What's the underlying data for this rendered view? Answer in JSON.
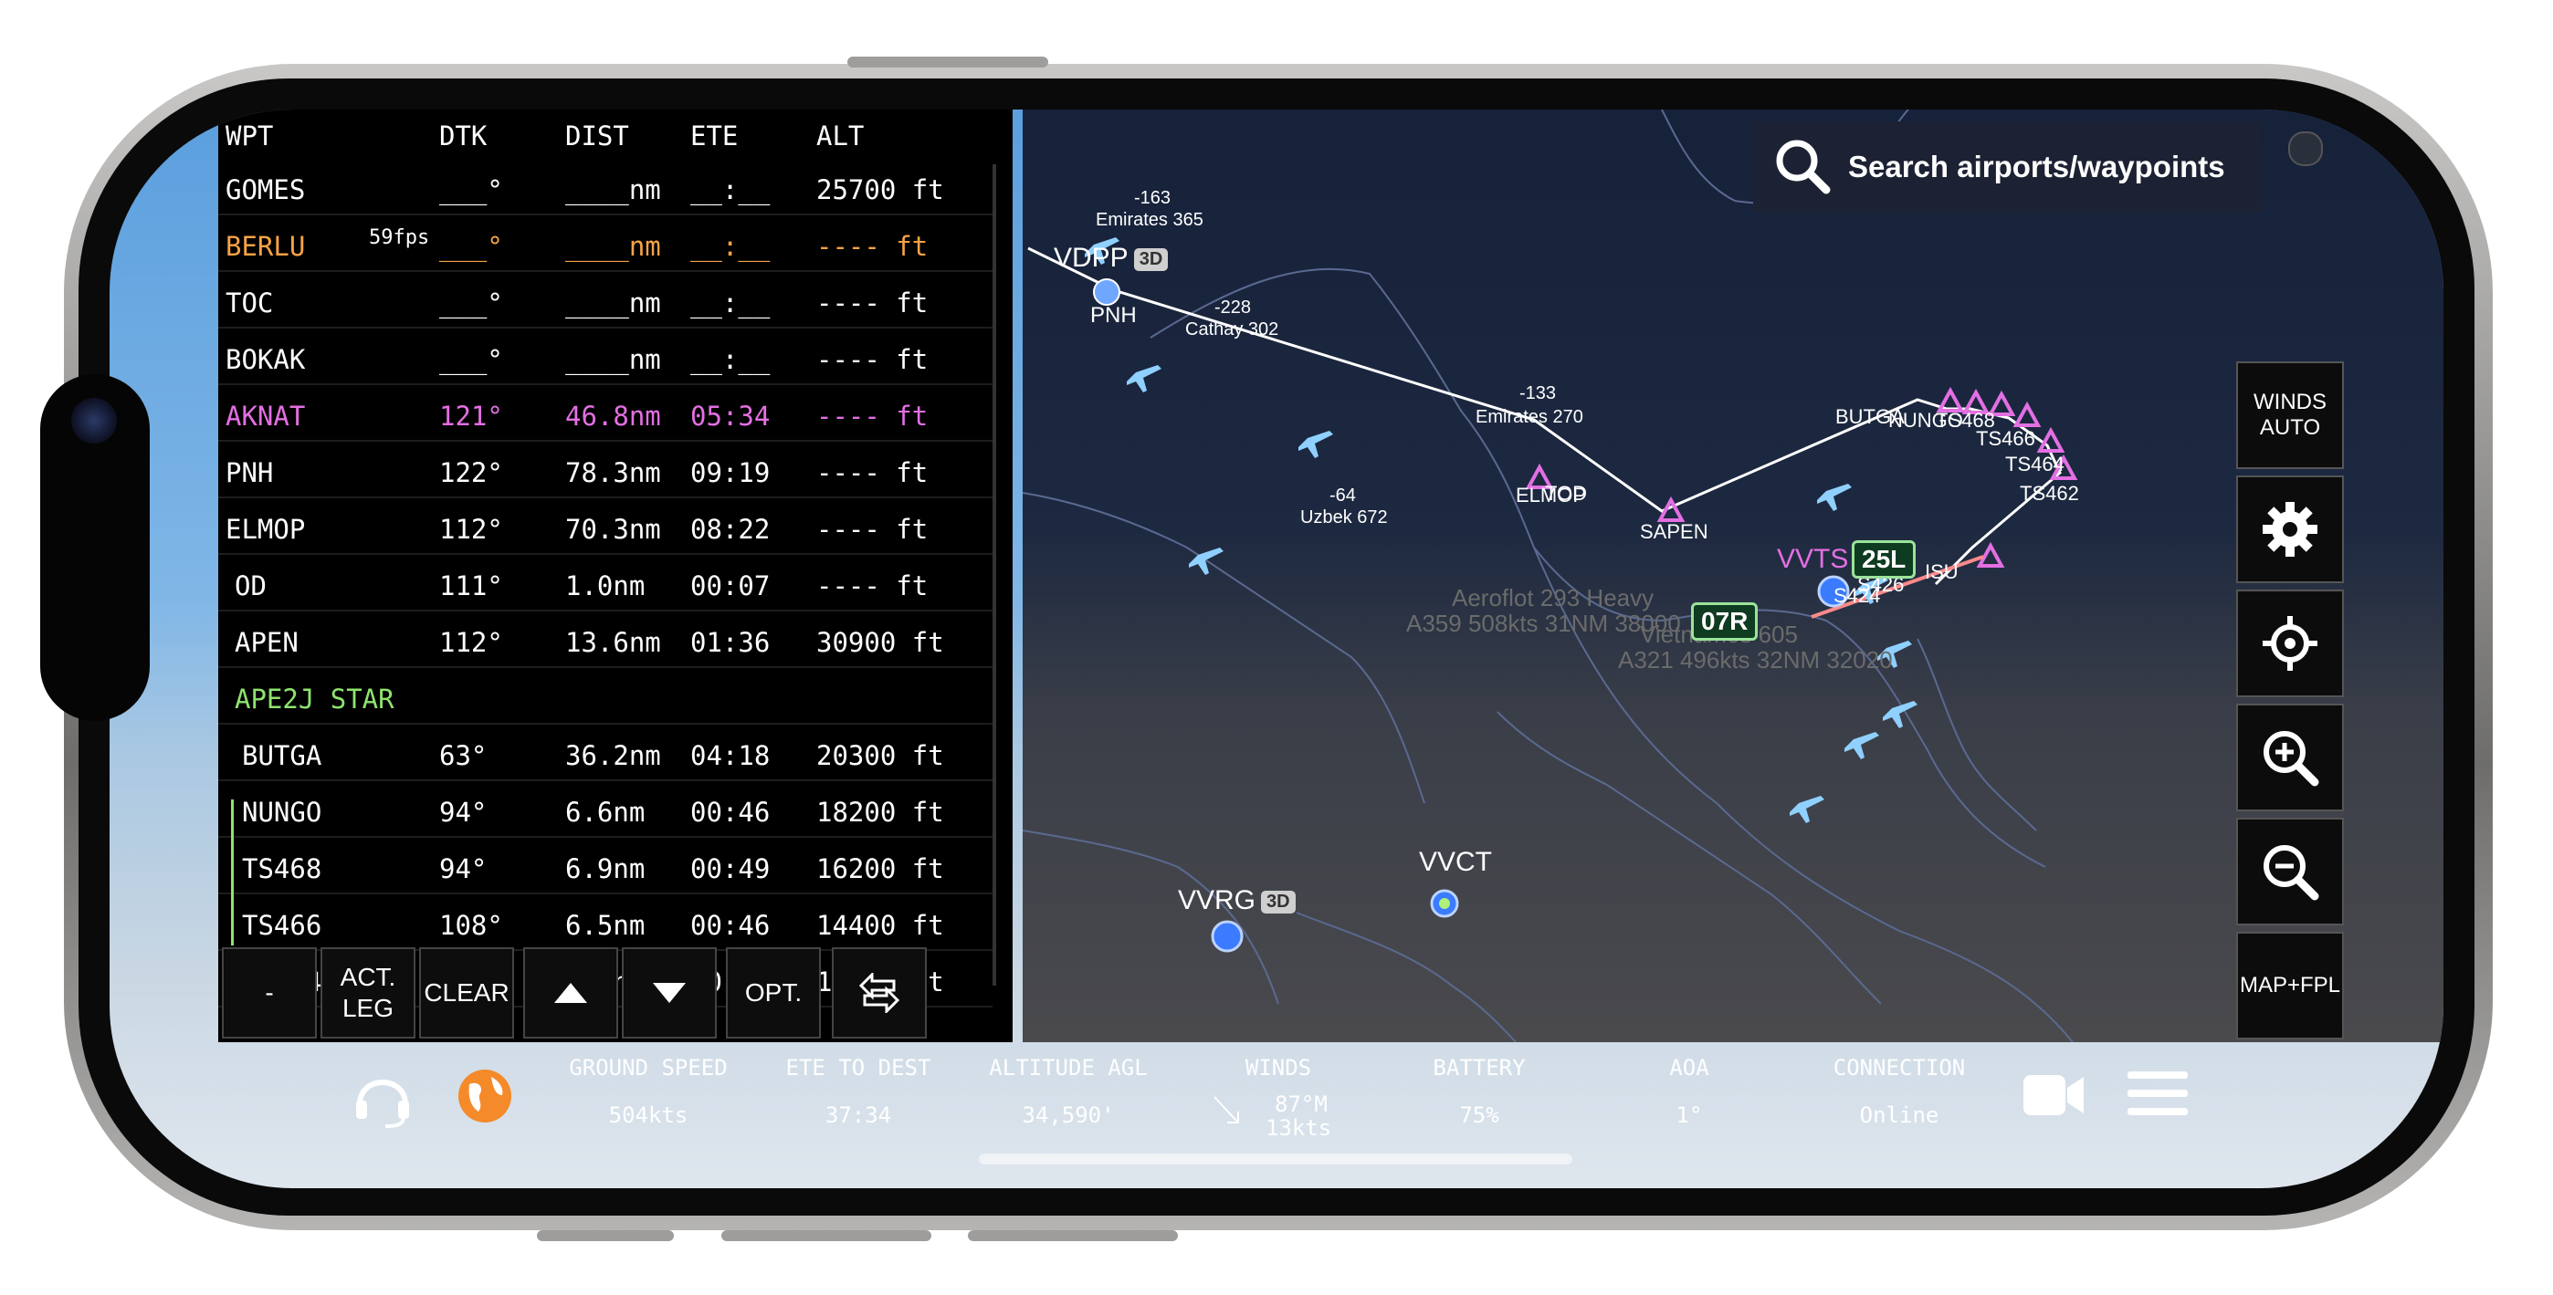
{
  "fpl": {
    "headers": [
      "WPT",
      "DTK",
      "DIST",
      "ETE",
      "ALT"
    ],
    "fps": "59fps",
    "rows": [
      {
        "wpt": "GOMES",
        "dtk": "___°",
        "dist": "____nm",
        "ete": "__:__",
        "alt": "25700 ft",
        "style": "normal"
      },
      {
        "wpt": "BERLU",
        "dtk": "___°",
        "dist": "____nm",
        "ete": "__:__",
        "alt": "---- ft",
        "style": "orange"
      },
      {
        "wpt": "TOC",
        "dtk": "___°",
        "dist": "____nm",
        "ete": "__:__",
        "alt": "---- ft",
        "style": "normal"
      },
      {
        "wpt": "BOKAK",
        "dtk": "___°",
        "dist": "____nm",
        "ete": "__:__",
        "alt": "---- ft",
        "style": "normal"
      },
      {
        "wpt": "AKNAT",
        "dtk": "121°",
        "dist": "46.8nm",
        "ete": "05:34",
        "alt": "---- ft",
        "style": "magenta"
      },
      {
        "wpt": "PNH",
        "dtk": "122°",
        "dist": "78.3nm",
        "ete": "09:19",
        "alt": "---- ft",
        "style": "normal"
      },
      {
        "wpt": "ELMOP",
        "dtk": "112°",
        "dist": "70.3nm",
        "ete": "08:22",
        "alt": "---- ft",
        "style": "normal"
      },
      {
        "wpt": "OD",
        "dtk": "111°",
        "dist": "1.0nm",
        "ete": "00:07",
        "alt": "---- ft",
        "style": "normal"
      },
      {
        "wpt": "APEN",
        "dtk": "112°",
        "dist": "13.6nm",
        "ete": "01:36",
        "alt": "30900 ft",
        "style": "normal"
      },
      {
        "wpt": "APE2J STAR",
        "dtk": "",
        "dist": "",
        "ete": "",
        "alt": "",
        "style": "star"
      },
      {
        "wpt": "BUTGA",
        "dtk": "63°",
        "dist": "36.2nm",
        "ete": "04:18",
        "alt": "20300 ft",
        "style": "normal"
      },
      {
        "wpt": "NUNGO",
        "dtk": "94°",
        "dist": "6.6nm",
        "ete": "00:46",
        "alt": "18200 ft",
        "style": "normal"
      },
      {
        "wpt": "TS468",
        "dtk": "94°",
        "dist": "6.9nm",
        "ete": "00:49",
        "alt": "16200 ft",
        "style": "normal"
      },
      {
        "wpt": "TS466",
        "dtk": "108°",
        "dist": "6.5nm",
        "ete": "00:46",
        "alt": "14400 ft",
        "style": "normal"
      },
      {
        "wpt": "TS464",
        "dtk": "125°",
        "dist": "6.5nm",
        "ete": "00:46",
        "alt": "12400 ft",
        "style": "normal"
      }
    ],
    "buttons": {
      "minus": "-",
      "act_leg_1": "ACT.",
      "act_leg_2": "LEG",
      "clear": "CLEAR",
      "opt": "OPT."
    }
  },
  "search": {
    "placeholder": "Search airports/waypoints"
  },
  "rail": {
    "winds_1": "WINDS",
    "winds_2": "AUTO",
    "map_fpl": "MAP+FPL"
  },
  "map": {
    "traffic": [
      {
        "alt": "-163",
        "name": "Emirates 365"
      },
      {
        "alt": "-228",
        "name": "Cathay 302"
      },
      {
        "alt": "-133",
        "name": "Emirates 270"
      },
      {
        "alt": "-64",
        "name": "Uzbek 672"
      }
    ],
    "ghost": [
      "Aeroflot 293 Heavy",
      "A359 508kts 31NM 38000",
      "Vietnames 605",
      "A321 496kts 32NM 32020"
    ],
    "airports": {
      "vdpp": "VDPP",
      "pnh": "PNH",
      "vvts": "VVTS",
      "vvrg": "VVRG",
      "vvct": "VVCT",
      "badge": "3D",
      "badge_short": "3"
    },
    "waypoints": {
      "elmop": "ELMOP",
      "tod": "TOD",
      "sapen": "SAPEN",
      "butga": "BUTGA",
      "nungo": "NUNGO",
      "ts468": "TS468",
      "ts466": "TS466",
      "ts464": "TS464",
      "ts462": "TS462",
      "s424": "S424",
      "s426": "S426",
      "isu": "ISU"
    },
    "runways": [
      "25L",
      "07R"
    ]
  },
  "bottom": {
    "ground_speed": {
      "label": "GROUND SPEED",
      "value": "504kts"
    },
    "ete": {
      "label": "ETE TO DEST",
      "value": "37:34"
    },
    "altitude": {
      "label": "ALTITUDE AGL",
      "value": "34,590'"
    },
    "winds": {
      "label": "WINDS",
      "value1": "87°M",
      "value2": "13kts"
    },
    "battery": {
      "label": "BATTERY",
      "value": "75%"
    },
    "aoa": {
      "label": "AOA",
      "value": "1°"
    },
    "connection": {
      "label": "CONNECTION",
      "value": "Online"
    }
  },
  "colors": {
    "accent": "#f7a346",
    "magenta": "#e36fe3",
    "star": "#8ee36e",
    "map_bg": "#16213a",
    "panel": "#000000"
  }
}
